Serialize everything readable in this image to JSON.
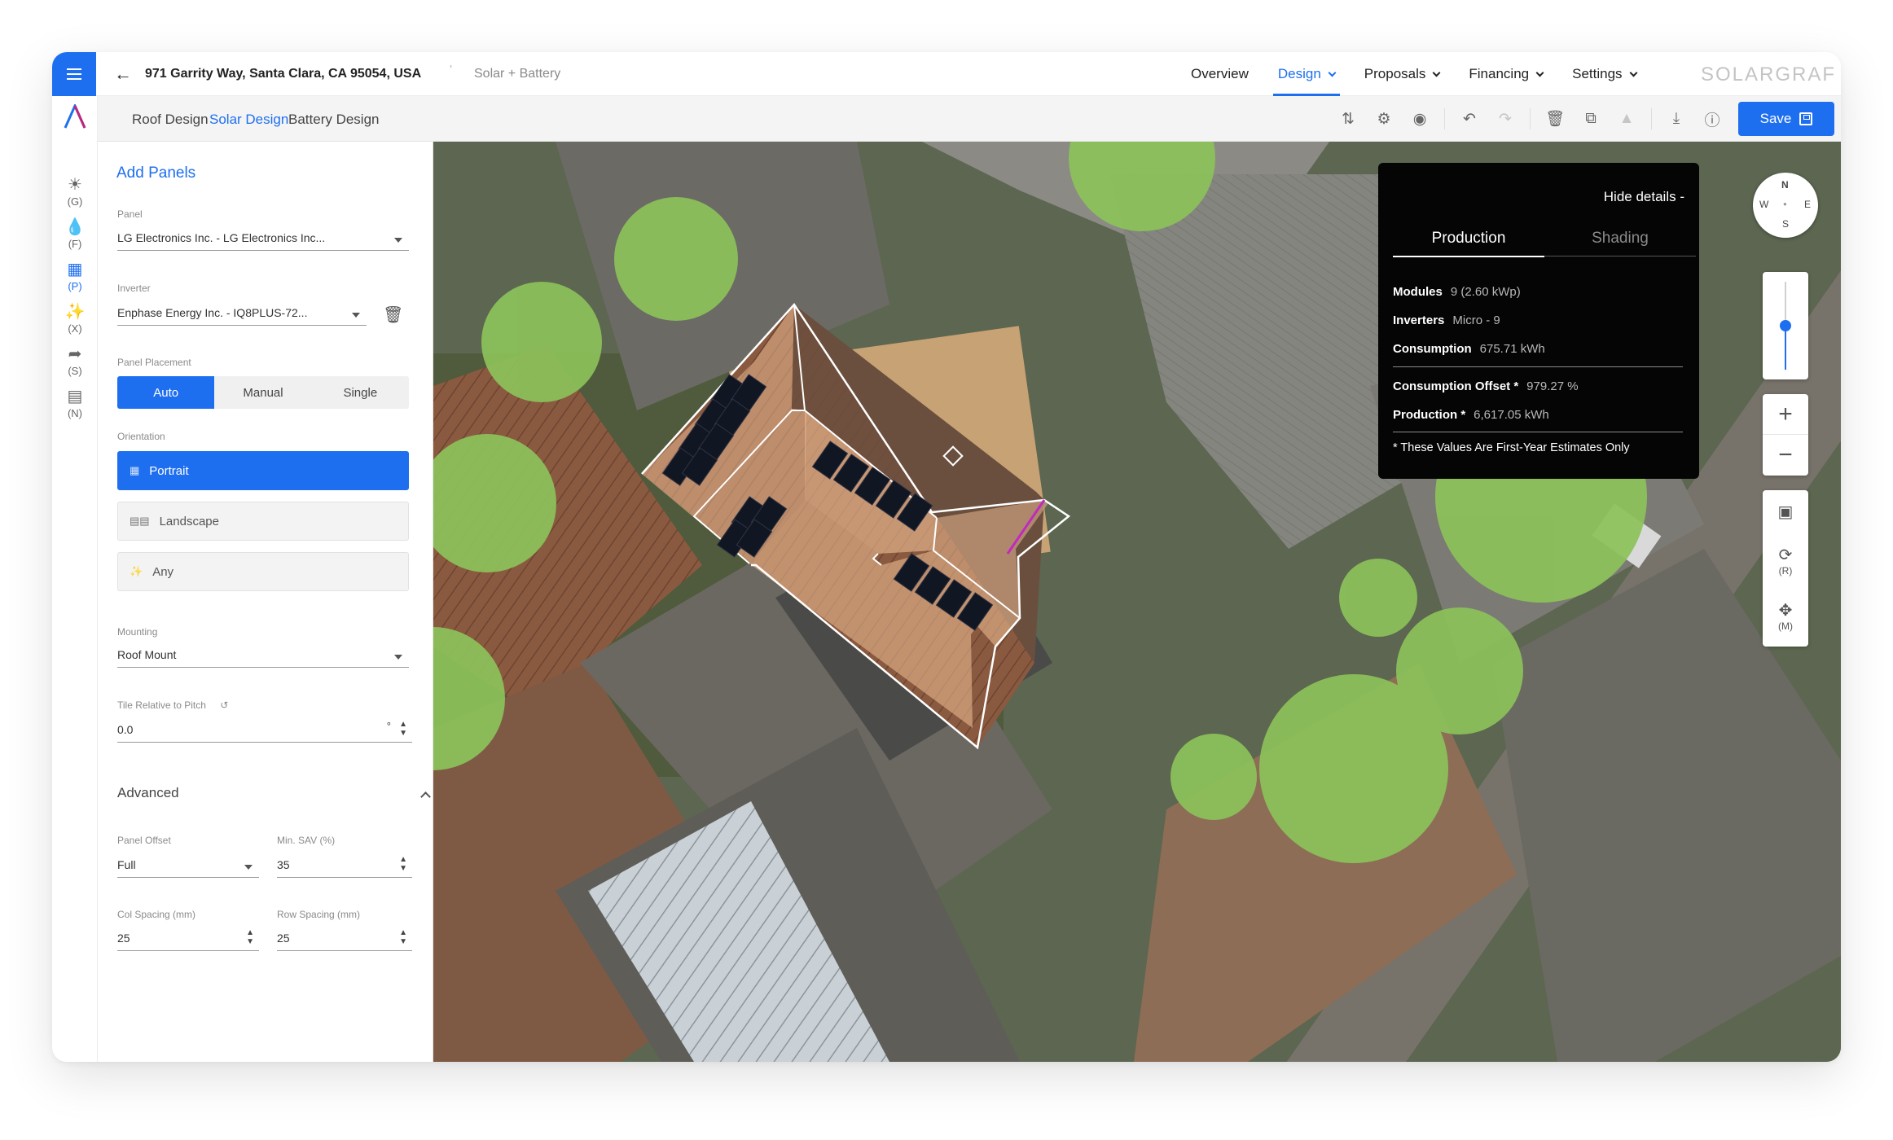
{
  "header": {
    "address": "971 Garrity Way, Santa Clara, CA 95054, USA",
    "separator": "'",
    "project_type": "Solar + Battery",
    "nav": [
      {
        "label": "Overview",
        "active": false,
        "dropdown": false
      },
      {
        "label": "Design",
        "active": true,
        "dropdown": true
      },
      {
        "label": "Proposals",
        "active": false,
        "dropdown": true
      },
      {
        "label": "Financing",
        "active": false,
        "dropdown": true
      },
      {
        "label": "Settings",
        "active": false,
        "dropdown": true
      }
    ],
    "brand": "SOLARGRAF"
  },
  "rail": {
    "items": [
      {
        "icon": "sun-icon",
        "label": "(G)",
        "active": false
      },
      {
        "icon": "flame-icon",
        "label": "(F)",
        "active": false
      },
      {
        "icon": "grid-icon",
        "label": "(P)",
        "active": true
      },
      {
        "icon": "magic-wand-icon",
        "label": "(X)",
        "active": false
      },
      {
        "icon": "cursor-icon",
        "label": "(S)",
        "active": false
      },
      {
        "icon": "ruler-icon",
        "label": "(N)",
        "active": false
      }
    ]
  },
  "subtabs": [
    "Roof Design",
    "Solar Design",
    "Battery Design"
  ],
  "toolbar": {
    "save_label": "Save"
  },
  "panel": {
    "title": "Add Panels",
    "panel_label": "Panel",
    "panel_value": "LG Electronics Inc. - LG Electronics Inc...",
    "inverter_label": "Inverter",
    "inverter_value": "Enphase Energy Inc. - IQ8PLUS-72...",
    "placement_label": "Panel Placement",
    "placement_options": [
      "Auto",
      "Manual",
      "Single"
    ],
    "orientation_label": "Orientation",
    "orientation_options": [
      "Portrait",
      "Landscape",
      "Any"
    ],
    "mounting_label": "Mounting",
    "mounting_value": "Roof Mount",
    "tilt_label": "Tile Relative to Pitch",
    "tilt_value": "0.0",
    "tilt_unit": "°",
    "advanced_label": "Advanced",
    "offset_label": "Panel Offset",
    "offset_value": "Full",
    "minsav_label": "Min. SAV (%)",
    "minsav_value": "35",
    "colspacing_label": "Col Spacing (mm)",
    "colspacing_value": "25",
    "rowspacing_label": "Row Spacing (mm)",
    "rowspacing_value": "25"
  },
  "details": {
    "hide_label": "Hide details -",
    "tabs": [
      "Production",
      "Shading"
    ],
    "modules_label": "Modules",
    "modules_value": "9 (2.60 kWp)",
    "inverters_label": "Inverters",
    "inverters_value": "Micro - 9",
    "consumption_label": "Consumption",
    "consumption_value": "675.71 kWh",
    "offset_label": "Consumption Offset *",
    "offset_value": "979.27 %",
    "production_label": "Production *",
    "production_value": "6,617.05 kWh",
    "note": "* These Values Are First-Year Estimates Only"
  },
  "compass": {
    "n": "N",
    "s": "S",
    "e": "E",
    "w": "W"
  },
  "map_controls": {
    "zoom_level": 0.5,
    "rotate_label": "(R)",
    "move_label": "(M)"
  },
  "colors": {
    "accent": "#1e6ff0",
    "tree": "#8cc25a",
    "roof_highlight": "#e8b890",
    "panel": "#101622"
  }
}
